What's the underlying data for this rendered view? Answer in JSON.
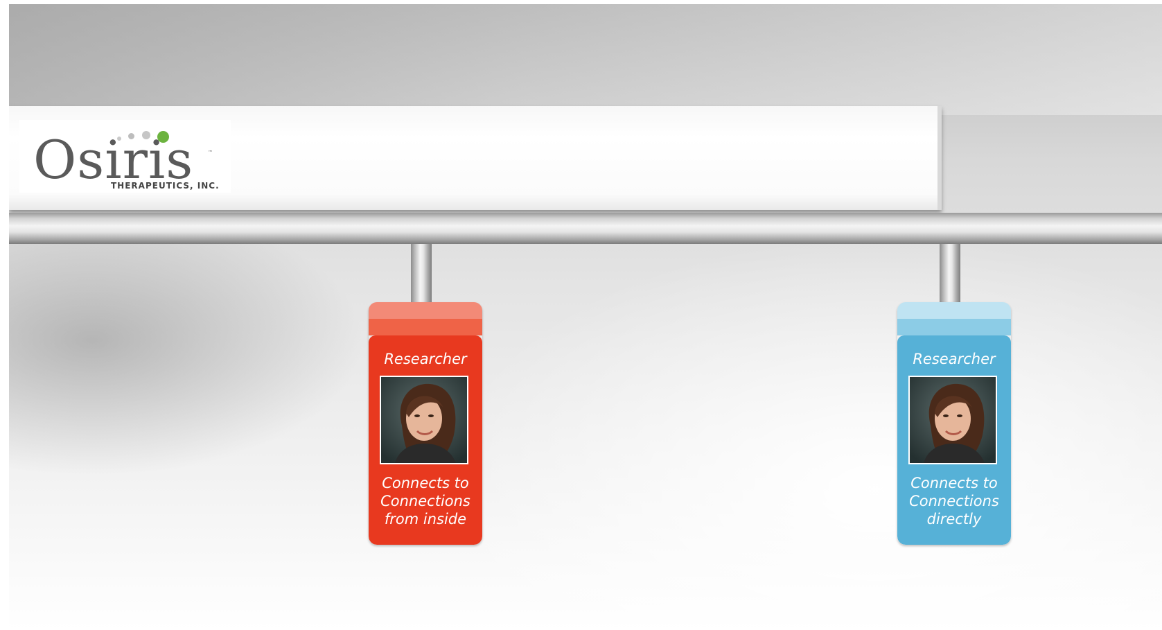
{
  "logo": {
    "wordmark": "Osiris",
    "trademark": "™",
    "subtitle": "THERAPEUTICS, INC.",
    "dot_colors": [
      "#c9c9c9",
      "#bdbdbd",
      "#c6c6c6",
      "#6cb33f"
    ]
  },
  "cards": [
    {
      "title": "Researcher",
      "desc_lines": [
        "Connects to",
        "Connections",
        "from inside"
      ],
      "colors": {
        "tab1": "#f38a77",
        "tab2": "#ef6347",
        "body": "#e8391f"
      }
    },
    {
      "title": "Researcher",
      "desc_lines": [
        "Connects to",
        "Connections",
        "directly"
      ],
      "colors": {
        "tab1": "#bfe3f2",
        "tab2": "#8ccce6",
        "body": "#56b1d7"
      }
    }
  ]
}
